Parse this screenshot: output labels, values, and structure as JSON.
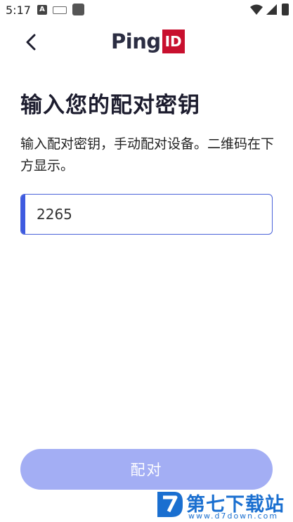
{
  "status_bar": {
    "time": "5:17",
    "icons": [
      "a-notification-icon",
      "keyboard-icon",
      "app-notification-icon",
      "wifi-icon",
      "signal-icon",
      "battery-icon"
    ]
  },
  "header": {
    "back_icon": "chevron-left-icon",
    "logo_ping": "Ping",
    "logo_id": "ID"
  },
  "main": {
    "title": "输入您的配对密钥",
    "instructions": "输入配对密钥，手动配对设备。二维码在下方显示。",
    "pairing_key_value": "2265"
  },
  "footer": {
    "pair_button_label": "配对"
  },
  "watermark": {
    "name": "第七下载站",
    "url": "www.d7down.com"
  },
  "colors": {
    "accent": "#3e5be0",
    "button_disabled": "#a3aef4",
    "logo_red": "#c8102e",
    "watermark_blue": "#1a6fd0"
  }
}
